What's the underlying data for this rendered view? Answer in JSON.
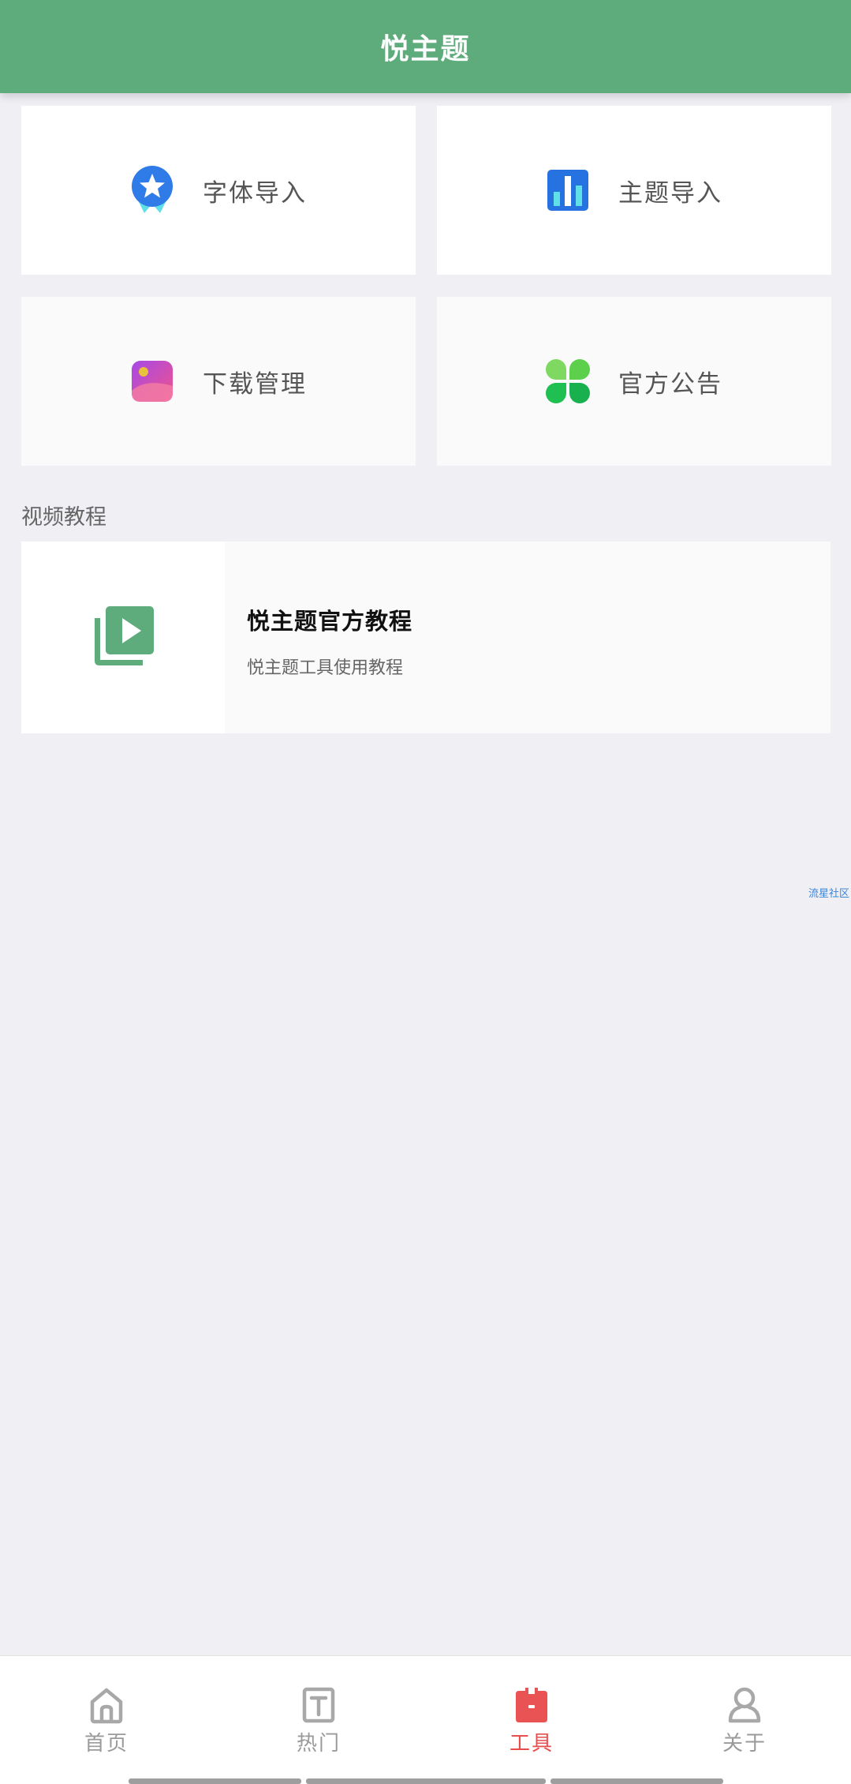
{
  "app_bar": {
    "title": "悦主题"
  },
  "tools": [
    {
      "label": "字体导入",
      "icon": "award-star-icon"
    },
    {
      "label": "主题导入",
      "icon": "bar-chart-icon"
    },
    {
      "label": "下载管理",
      "icon": "image-gallery-icon"
    },
    {
      "label": "官方公告",
      "icon": "clover-icon"
    }
  ],
  "video_section": {
    "title": "视频教程",
    "card": {
      "title": "悦主题官方教程",
      "subtitle": "悦主题工具使用教程",
      "icon": "video-library-icon"
    }
  },
  "watermark": "流星社区",
  "bottom_nav": {
    "items": [
      {
        "label": "首页",
        "icon": "home-icon",
        "active": false
      },
      {
        "label": "热门",
        "icon": "text-t-icon",
        "active": false
      },
      {
        "label": "工具",
        "icon": "toolbox-icon",
        "active": true
      },
      {
        "label": "关于",
        "icon": "user-icon",
        "active": false
      }
    ]
  },
  "colors": {
    "primary": "#5eac7b",
    "active_tab": "#e84e4e",
    "inactive_tab": "#9a9a9a",
    "background": "#efeff4"
  }
}
